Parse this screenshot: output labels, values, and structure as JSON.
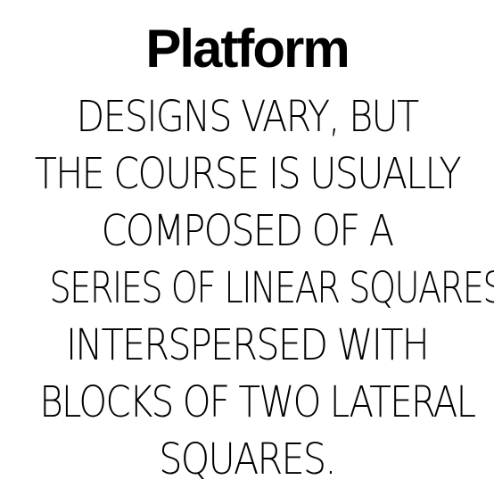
{
  "title": "Platform",
  "body_lines": [
    "DESIGNS VARY, BUT",
    "THE COURSE IS USUALLY",
    "COMPOSED OF A",
    "SERIES OF LINEAR SQUARES",
    "INTERSPERSED WITH",
    "BLOCKS OF TWO LATERAL",
    "SQUARES."
  ],
  "colors": {
    "text": "#000000",
    "background": "#ffffff"
  }
}
